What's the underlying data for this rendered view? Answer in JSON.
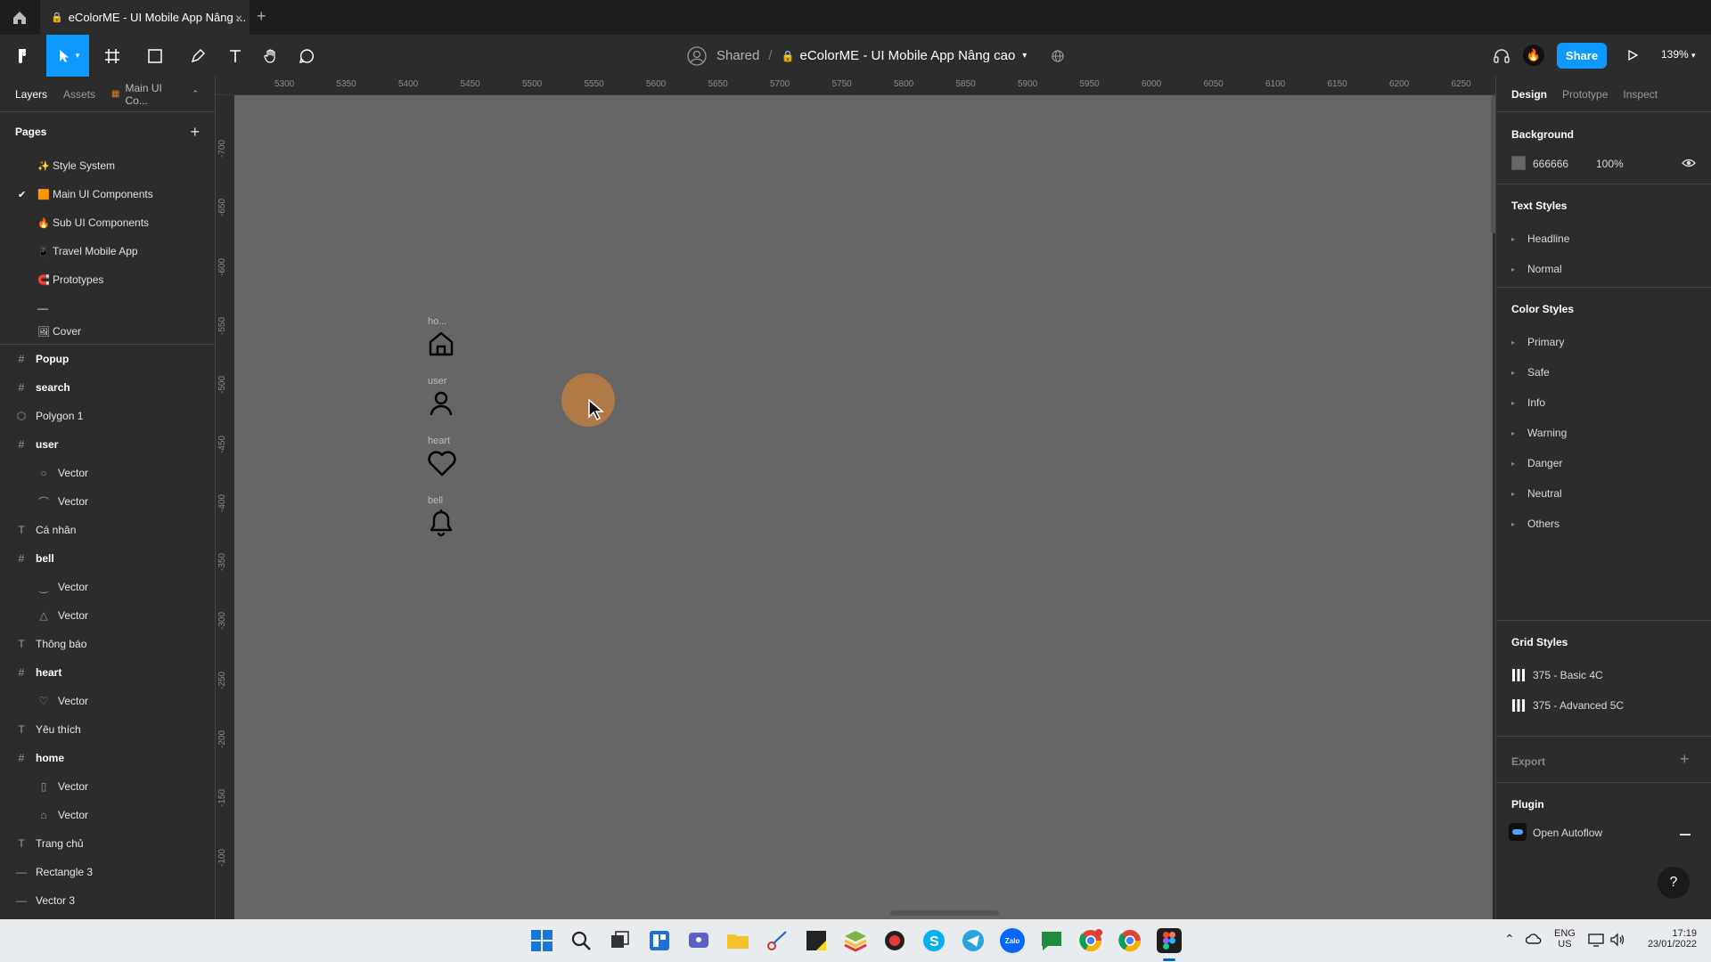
{
  "browser": {
    "tab_title": "eColorME - UI Mobile App Nâng ...",
    "tab_close": "×",
    "new_tab": "+"
  },
  "toolbar": {
    "shared_label": "Shared",
    "separator": "/",
    "file_name": "eColorME - UI Mobile App Nâng cao",
    "share_label": "Share",
    "zoom": "139%"
  },
  "left_panel": {
    "tabs": [
      "Layers",
      "Assets",
      "Main UI Co..."
    ],
    "pages_heading": "Pages",
    "pages": [
      {
        "emoji": "✨",
        "label": "Style System",
        "current": false
      },
      {
        "emoji": "🟧",
        "label": "Main UI Components",
        "current": true
      },
      {
        "emoji": "🔥",
        "label": "Sub UI Components",
        "current": false
      },
      {
        "emoji": "📱",
        "label": "Travel Mobile App",
        "current": false
      },
      {
        "emoji": "🧲",
        "label": "Prototypes",
        "current": false
      },
      {
        "emoji": "",
        "label": "—",
        "current": false
      },
      {
        "emoji": "🖼",
        "label": "Cover",
        "current": false
      }
    ],
    "layers": [
      {
        "icon": "#",
        "label": "Popup",
        "indent": 0,
        "frame": true
      },
      {
        "icon": "#",
        "label": "search",
        "indent": 0,
        "frame": true
      },
      {
        "icon": "⬡",
        "label": "Polygon 1",
        "indent": 0,
        "frame": false
      },
      {
        "icon": "#",
        "label": "user",
        "indent": 0,
        "frame": true
      },
      {
        "icon": "○",
        "label": "Vector",
        "indent": 1,
        "frame": false
      },
      {
        "icon": "⌒",
        "label": "Vector",
        "indent": 1,
        "frame": false
      },
      {
        "icon": "T",
        "label": "Cá nhân",
        "indent": 0,
        "frame": false
      },
      {
        "icon": "#",
        "label": "bell",
        "indent": 0,
        "frame": true
      },
      {
        "icon": "‿",
        "label": "Vector",
        "indent": 1,
        "frame": false
      },
      {
        "icon": "△",
        "label": "Vector",
        "indent": 1,
        "frame": false
      },
      {
        "icon": "T",
        "label": "Thông báo",
        "indent": 0,
        "frame": false
      },
      {
        "icon": "#",
        "label": "heart",
        "indent": 0,
        "frame": true
      },
      {
        "icon": "♡",
        "label": "Vector",
        "indent": 1,
        "frame": false
      },
      {
        "icon": "T",
        "label": "Yêu thích",
        "indent": 0,
        "frame": false
      },
      {
        "icon": "#",
        "label": "home",
        "indent": 0,
        "frame": true
      },
      {
        "icon": "▯",
        "label": "Vector",
        "indent": 1,
        "frame": false
      },
      {
        "icon": "⌂",
        "label": "Vector",
        "indent": 1,
        "frame": false
      },
      {
        "icon": "T",
        "label": "Trang chủ",
        "indent": 0,
        "frame": false
      },
      {
        "icon": "—",
        "label": "Rectangle 3",
        "indent": 0,
        "frame": false
      },
      {
        "icon": "—",
        "label": "Vector 3",
        "indent": 0,
        "frame": false
      }
    ]
  },
  "rulers": {
    "top": [
      "5300",
      "5350",
      "5400",
      "5450",
      "5500",
      "5550",
      "5600",
      "5650",
      "5700",
      "5750",
      "5800",
      "5850",
      "5900",
      "5950",
      "6000",
      "6050",
      "6100",
      "6150",
      "6200",
      "6250"
    ],
    "left": [
      "-700",
      "-650",
      "-600",
      "-550",
      "-500",
      "-450",
      "-400",
      "-350",
      "-300",
      "-250",
      "-200",
      "-150",
      "-100"
    ]
  },
  "canvas": {
    "background": "#666666",
    "icons": [
      {
        "label": "ho...",
        "icon": "home-icon"
      },
      {
        "label": "user",
        "icon": "user-icon"
      },
      {
        "label": "heart",
        "icon": "heart-icon"
      },
      {
        "label": "bell",
        "icon": "bell-icon"
      }
    ]
  },
  "right_panel": {
    "tabs": [
      "Design",
      "Prototype",
      "Inspect"
    ],
    "background_heading": "Background",
    "background_hex": "666666",
    "background_opacity": "100%",
    "text_styles_heading": "Text Styles",
    "text_styles": [
      "Headline",
      "Normal"
    ],
    "color_styles_heading": "Color Styles",
    "color_styles": [
      "Primary",
      "Safe",
      "Info",
      "Warning",
      "Danger",
      "Neutral",
      "Others"
    ],
    "grid_styles_heading": "Grid Styles",
    "grid_styles": [
      "375 - Basic 4C",
      "375 - Advanced 5C"
    ],
    "export_heading": "Export",
    "plugin_heading": "Plugin",
    "plugin_name": "Open Autoflow",
    "help": "?"
  },
  "taskbar": {
    "lang": "ENG",
    "region": "US",
    "time": "17:19",
    "date": "23/01/2022",
    "zalo": "Zalo"
  },
  "colors": {
    "accent": "#0d99ff",
    "canvas": "#666666"
  }
}
